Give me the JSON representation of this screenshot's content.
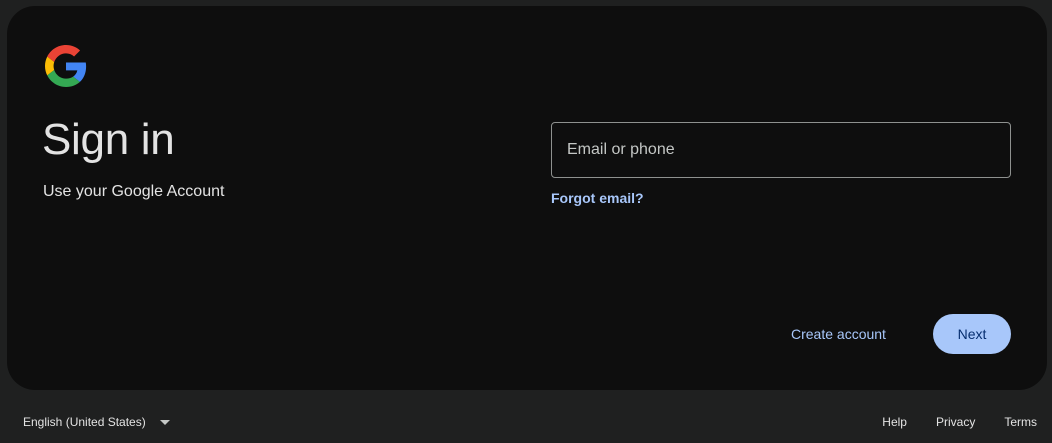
{
  "signin": {
    "title": "Sign in",
    "subtitle": "Use your Google Account",
    "email_placeholder": "Email or phone",
    "email_value": "",
    "forgot_email": "Forgot email?",
    "create_account": "Create account",
    "next": "Next"
  },
  "footer": {
    "language": "English (United States)",
    "links": [
      "Help",
      "Privacy",
      "Terms"
    ]
  },
  "colors": {
    "page_bg": "#1f2020",
    "card_bg": "#0e0e0e",
    "text": "#e3e3e3",
    "link": "#a8c7fa",
    "button_bg": "#a8c7fa",
    "button_text": "#062e6f"
  },
  "icons": {
    "logo": "google-g-logo",
    "language_caret": "caret-down-icon"
  }
}
